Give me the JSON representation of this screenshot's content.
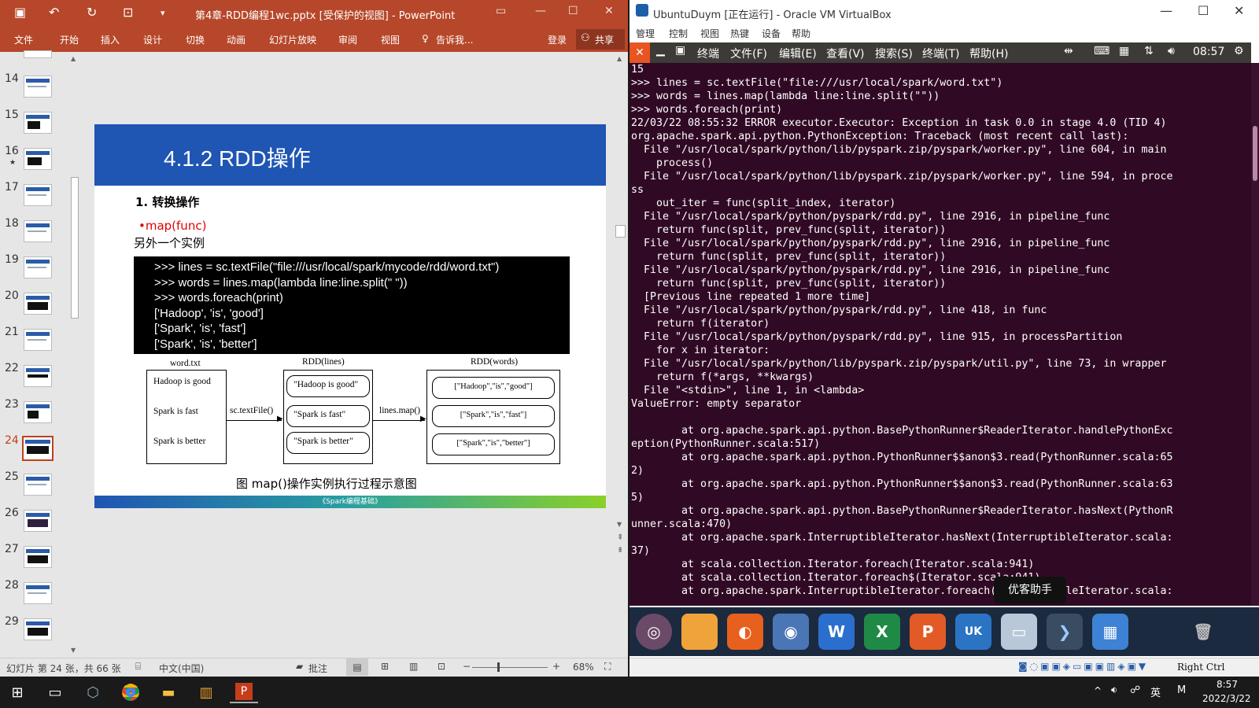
{
  "ppt": {
    "title": "第4章-RDD编程1wc.pptx [受保护的视图] - PowerPoint",
    "tabs": [
      "文件",
      "开始",
      "插入",
      "设计",
      "切换",
      "动画",
      "幻灯片放映",
      "审阅",
      "视图"
    ],
    "tell_me": "告诉我...",
    "login": "登录",
    "share": "共享",
    "thumb_numbers": [
      "14",
      "15",
      "16",
      "17",
      "18",
      "19",
      "20",
      "21",
      "22",
      "23",
      "24",
      "25",
      "26",
      "27",
      "28",
      "29"
    ],
    "thumb_star": "★",
    "slide": {
      "title": "4.1.2 RDD操作",
      "section": "1. 转换操作",
      "bullet": "•map(func)",
      "subtitle": "另外一个实例",
      "code": [
        ">>> lines = sc.textFile(\"file:///usr/local/spark/mycode/rdd/word.txt\")",
        ">>> words = lines.map(lambda line:line.split(\" \"))",
        ">>> words.foreach(print)",
        "['Hadoop', 'is', 'good']",
        "['Spark', 'is', 'fast']",
        "['Spark', 'is', 'better']"
      ],
      "diagram": {
        "box1_title": "word.txt",
        "box1_lines": [
          "Hadoop is good",
          "Spark is fast",
          "Spark is better"
        ],
        "arrow1": "sc.textFile()",
        "box2_title": "RDD(lines)",
        "box2_lines": [
          "\"Hadoop is good\"",
          "\"Spark is fast\"",
          "\"Spark is better\""
        ],
        "arrow2": "lines.map()",
        "box3_title": "RDD(words)",
        "box3_lines": [
          "[\"Hadoop\",\"is\",\"good\"]",
          "[\"Spark\",\"is\",\"fast\"]",
          "[\"Spark\",\"is\",\"better\"]"
        ]
      },
      "caption": "图 map()操作实例执行过程示意图",
      "footer": "《Spark编程基础》"
    },
    "status": {
      "slide_count": "幻灯片 第 24 张，共 66 张",
      "language": "中文(中国)",
      "comments": "批注",
      "zoom": "68%"
    }
  },
  "vbox": {
    "title": "UbuntuDuym [正在运行] - Oracle VM VirtualBox",
    "menu": [
      "管理",
      "控制",
      "视图",
      "热键",
      "设备",
      "帮助"
    ],
    "term_menu": [
      "终端",
      "文件(F)",
      "编辑(E)",
      "查看(V)",
      "搜索(S)",
      "终端(T)",
      "帮助(H)"
    ],
    "clock": "08:57",
    "terminal_lines": [
      "15",
      ">>> lines = sc.textFile(\"file:///usr/local/spark/word.txt\")",
      ">>> words = lines.map(lambda line:line.split(\"\"))",
      ">>> words.foreach(print)",
      "22/03/22 08:55:32 ERROR executor.Executor: Exception in task 0.0 in stage 4.0 (TID 4)",
      "org.apache.spark.api.python.PythonException: Traceback (most recent call last):",
      "  File \"/usr/local/spark/python/lib/pyspark.zip/pyspark/worker.py\", line 604, in main",
      "    process()",
      "  File \"/usr/local/spark/python/lib/pyspark.zip/pyspark/worker.py\", line 594, in proce",
      "ss",
      "    out_iter = func(split_index, iterator)",
      "  File \"/usr/local/spark/python/pyspark/rdd.py\", line 2916, in pipeline_func",
      "    return func(split, prev_func(split, iterator))",
      "  File \"/usr/local/spark/python/pyspark/rdd.py\", line 2916, in pipeline_func",
      "    return func(split, prev_func(split, iterator))",
      "  File \"/usr/local/spark/python/pyspark/rdd.py\", line 2916, in pipeline_func",
      "    return func(split, prev_func(split, iterator))",
      "  [Previous line repeated 1 more time]",
      "  File \"/usr/local/spark/python/pyspark/rdd.py\", line 418, in func",
      "    return f(iterator)",
      "  File \"/usr/local/spark/python/pyspark/rdd.py\", line 915, in processPartition",
      "    for x in iterator:",
      "  File \"/usr/local/spark/python/lib/pyspark.zip/pyspark/util.py\", line 73, in wrapper",
      "    return f(*args, **kwargs)",
      "  File \"<stdin>\", line 1, in <lambda>",
      "ValueError: empty separator",
      "",
      "        at org.apache.spark.api.python.BasePythonRunner$ReaderIterator.handlePythonExc",
      "eption(PythonRunner.scala:517)",
      "        at org.apache.spark.api.python.PythonRunner$$anon$3.read(PythonRunner.scala:65",
      "2)",
      "        at org.apache.spark.api.python.PythonRunner$$anon$3.read(PythonRunner.scala:63",
      "5)",
      "        at org.apache.spark.api.python.BasePythonRunner$ReaderIterator.hasNext(PythonR",
      "unner.scala:470)",
      "        at org.apache.spark.InterruptibleIterator.hasNext(InterruptibleIterator.scala:",
      "37)",
      "        at scala.collection.Iterator.foreach(Iterator.scala:941)",
      "        at scala.collection.Iterator.foreach$(Iterator.scala:941)",
      "        at org.apache.spark.InterruptibleIterator.foreach(InterruptibleIterator.scala:"
    ],
    "tooltip": "优客助手",
    "host_key": "Right Ctrl"
  },
  "taskbar": {
    "time": "8:57",
    "date": "2022/3/22",
    "ime": "英",
    "ime2": "M"
  }
}
